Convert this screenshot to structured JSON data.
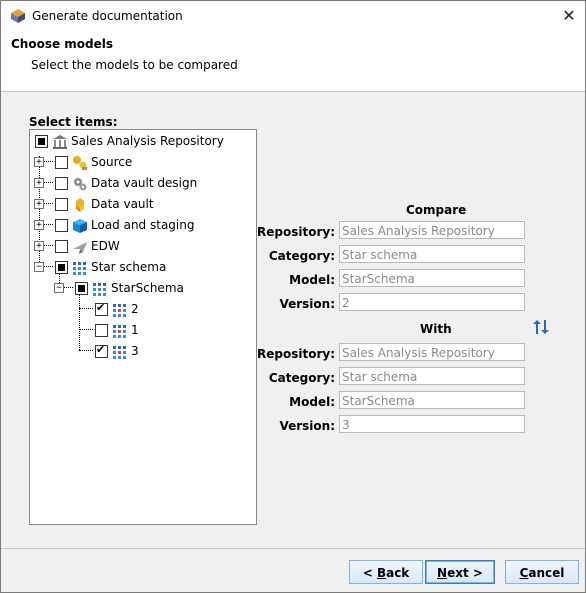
{
  "window": {
    "title": "Generate documentation",
    "close_glyph": "✕"
  },
  "header": {
    "title": "Choose models",
    "subtitle": "Select the models to be compared"
  },
  "tree_label": "Select items:",
  "tree": {
    "root": {
      "label": "Sales Analysis Repository",
      "state": "partial",
      "icon": "bank-icon"
    },
    "items": [
      {
        "label": "Source",
        "state": "unchecked",
        "icon": "source-icon",
        "expander": "+"
      },
      {
        "label": "Data vault design",
        "state": "unchecked",
        "icon": "gear-icon",
        "expander": "+"
      },
      {
        "label": "Data vault",
        "state": "unchecked",
        "icon": "data-vault-icon",
        "expander": "+"
      },
      {
        "label": "Load and staging",
        "state": "unchecked",
        "icon": "cube-icon",
        "expander": "+"
      },
      {
        "label": "EDW",
        "state": "unchecked",
        "icon": "plane-icon",
        "expander": "+"
      },
      {
        "label": "Star schema",
        "state": "partial",
        "icon": "grid-icon",
        "expander": "−"
      }
    ],
    "model": {
      "label": "StarSchema",
      "state": "partial",
      "icon": "grid-icon",
      "expander": "−"
    },
    "versions": [
      {
        "label": "2",
        "state": "checked",
        "icon": "grid-icon"
      },
      {
        "label": "1",
        "state": "unchecked",
        "icon": "grid-icon"
      },
      {
        "label": "3",
        "state": "checked",
        "icon": "grid-icon"
      }
    ]
  },
  "compare": {
    "title": "Compare",
    "repository_label": "Repository:",
    "repository": "Sales Analysis Repository",
    "category_label": "Category:",
    "category": "Star schema",
    "model_label": "Model:",
    "model": "StarSchema",
    "version_label": "Version:",
    "version": "2"
  },
  "with": {
    "title": "With",
    "repository_label": "Repository:",
    "repository": "Sales Analysis Repository",
    "category_label": "Category:",
    "category": "Star schema",
    "model_label": "Model:",
    "model": "StarSchema",
    "version_label": "Version:",
    "version": "3"
  },
  "buttons": {
    "back": {
      "prefix": "< ",
      "mnemonic": "B",
      "rest": "ack"
    },
    "next": {
      "prefix": "",
      "mnemonic": "N",
      "rest": "ext >"
    },
    "cancel": {
      "prefix": "",
      "mnemonic": "C",
      "rest": "ancel"
    }
  },
  "colors": {
    "accent": "#3c7fb1",
    "button_border": "#7eb4ea",
    "disabled_text": "#8a8a8a"
  }
}
